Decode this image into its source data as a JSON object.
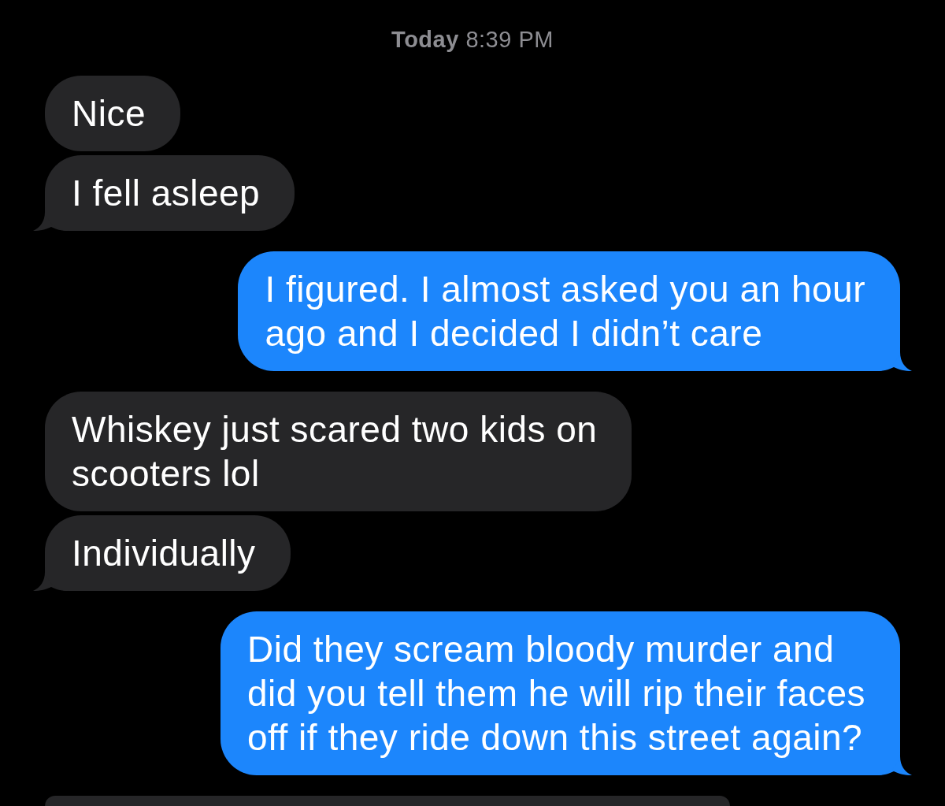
{
  "timestamp": "**Today** 8:39 PM",
  "messages": [
    {
      "kind": "received",
      "tail": false,
      "lines": [
        "Nice"
      ]
    },
    {
      "kind": "received",
      "tail": true,
      "lines": [
        "I fell asleep"
      ]
    },
    {
      "kind": "sent",
      "tail": true,
      "lines": [
        "I figured. I almost asked you an hour",
        "ago and I decided I didn’t care"
      ]
    },
    {
      "kind": "received",
      "tail": false,
      "lines": [
        "Whiskey just scared two kids on",
        "scooters lol"
      ]
    },
    {
      "kind": "received",
      "tail": true,
      "lines": [
        "Individually"
      ]
    },
    {
      "kind": "sent",
      "tail": true,
      "lines": [
        "Did they scream bloody murder and",
        "did you tell them he will rip their faces",
        "off if they ride down this street again?"
      ]
    },
    {
      "kind": "received",
      "tail": false,
      "cut_off": true
    }
  ]
}
